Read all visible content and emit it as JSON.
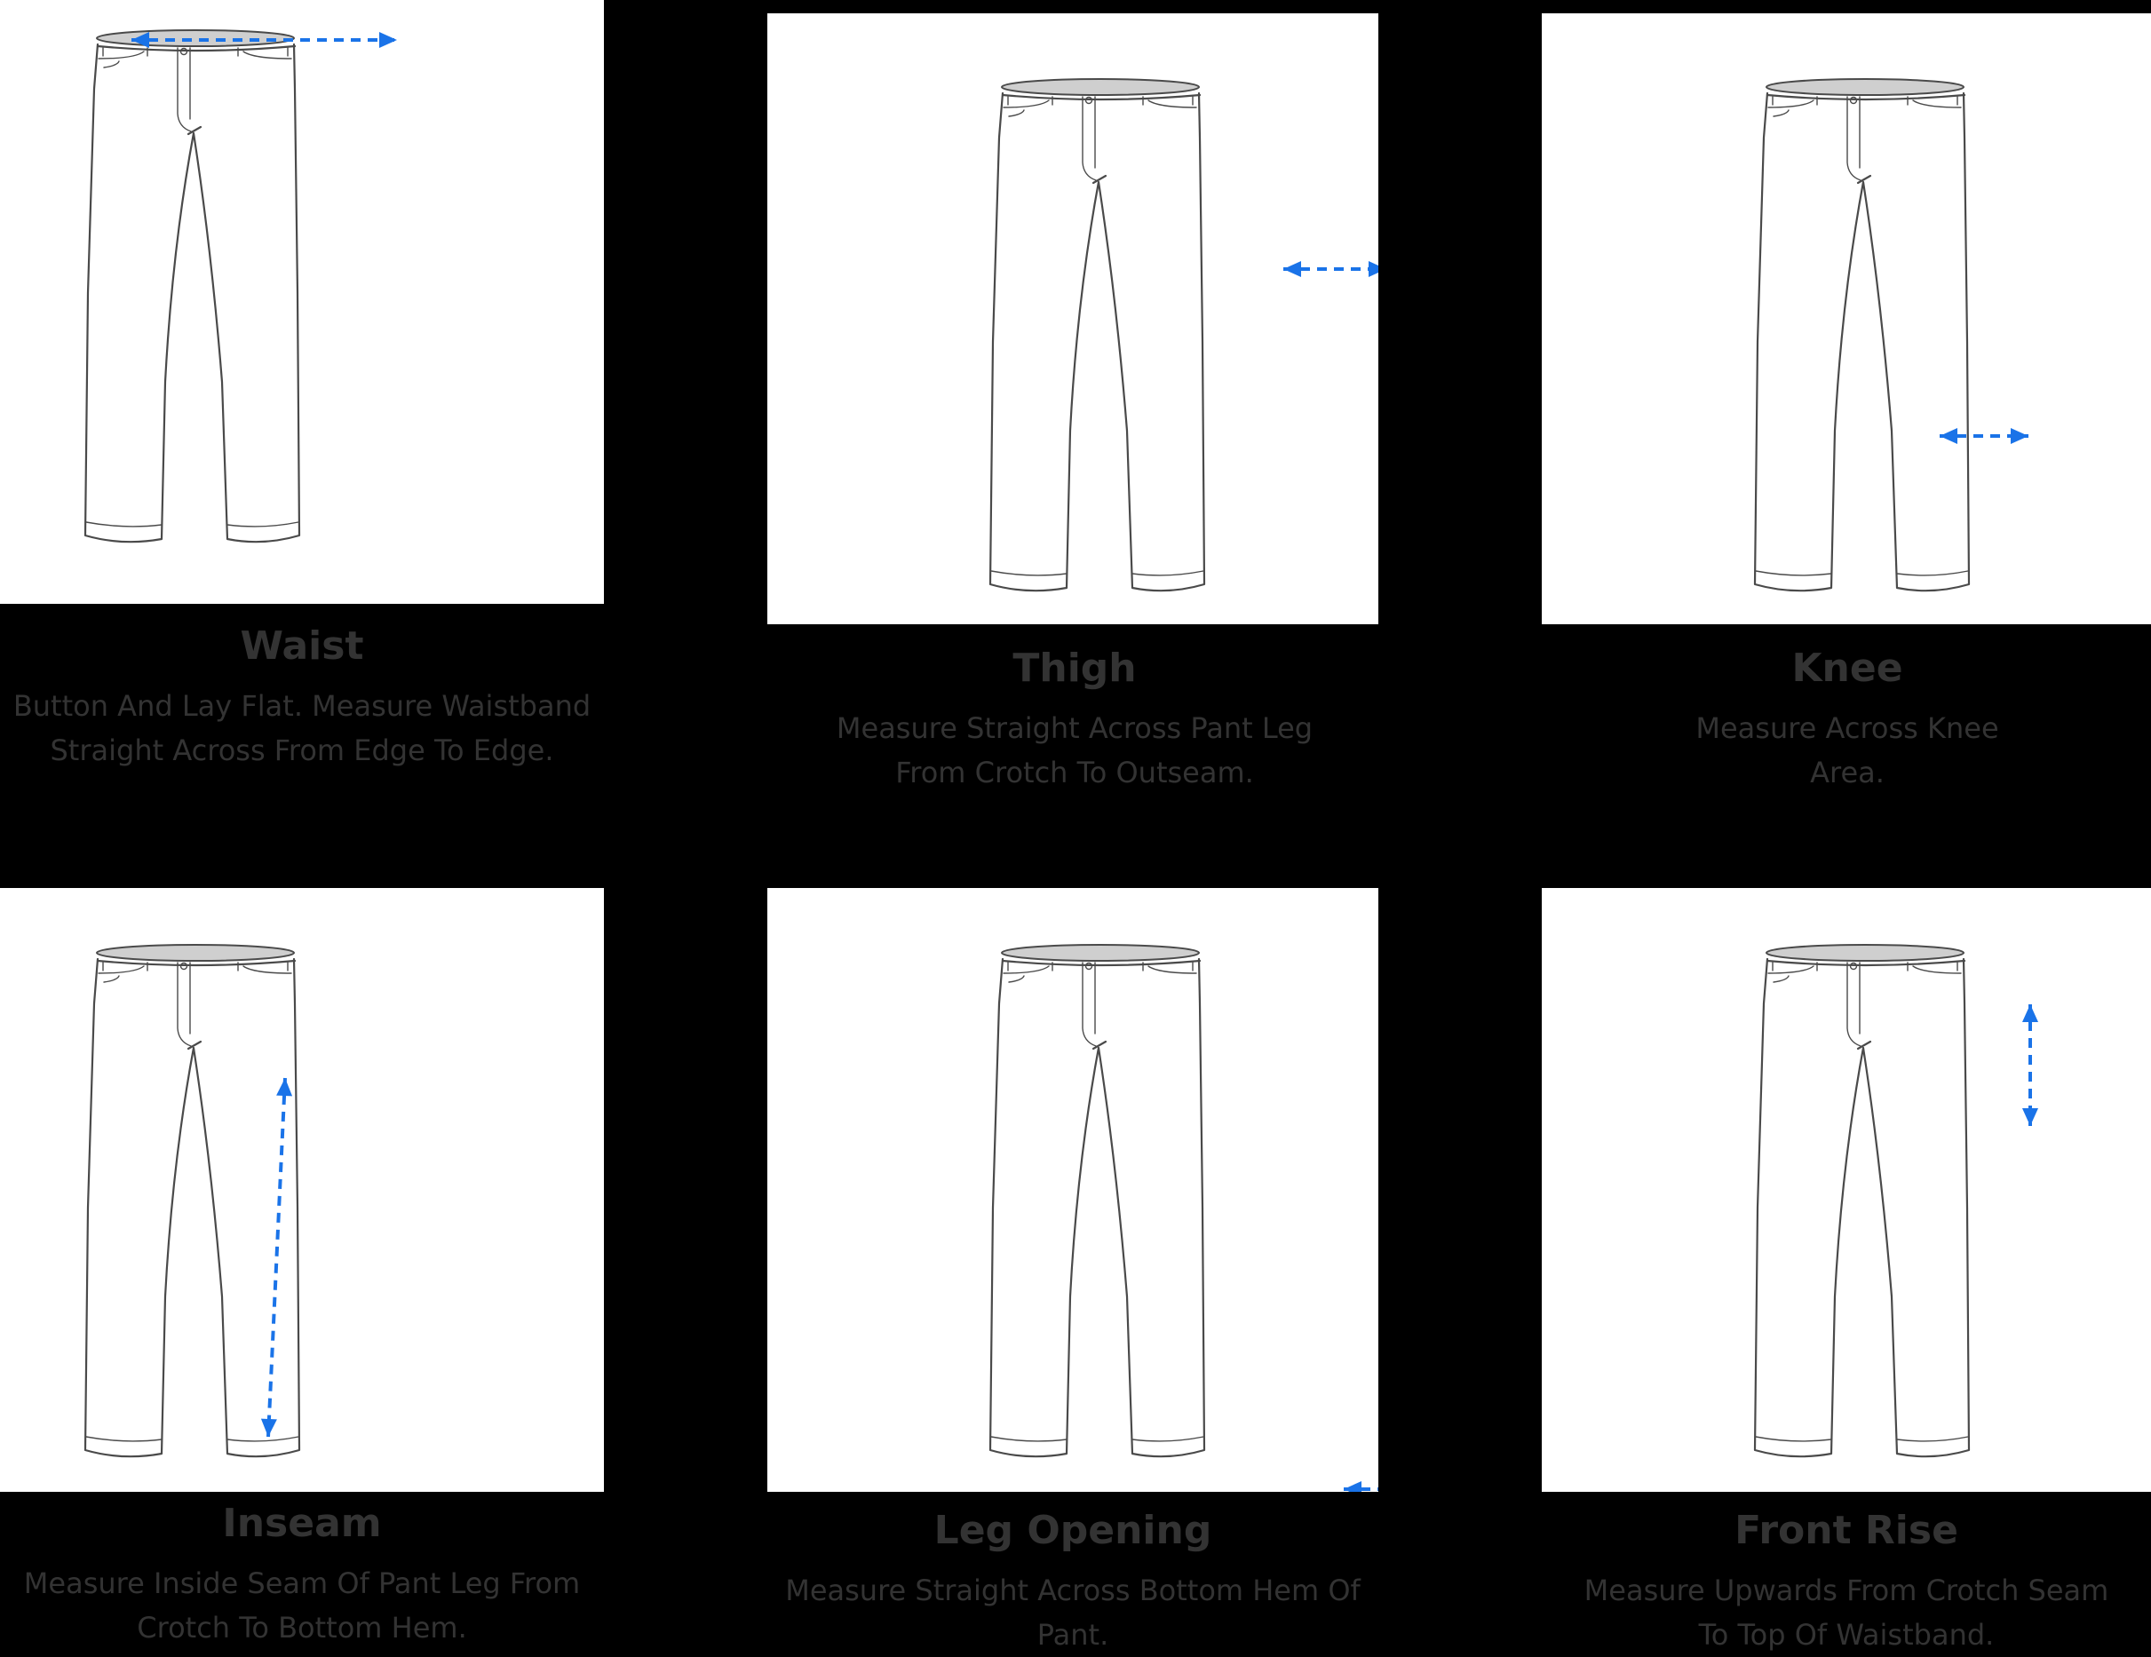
{
  "colors": {
    "page_background": "#000000",
    "panel_background": "#ffffff",
    "garment_line": "#4a4a4a",
    "waistband_fill": "#cfcfcf",
    "arrow": "#1a73e8",
    "caption_text": "#333333"
  },
  "panels": [
    {
      "measurement": "waist",
      "title": "Waist",
      "description": "Button And Lay Flat. Measure Waistband Straight Across From Edge To Edge."
    },
    {
      "measurement": "thigh",
      "title": "Thigh",
      "description": "Measure Straight Across Pant Leg From Crotch To Outseam."
    },
    {
      "measurement": "knee",
      "title": "Knee",
      "description": "Measure Across Knee Area."
    },
    {
      "measurement": "inseam",
      "title": "Inseam",
      "description": "Measure Inside Seam Of Pant Leg From Crotch To Bottom Hem."
    },
    {
      "measurement": "leg-opening",
      "title": "Leg Opening",
      "description": "Measure Straight Across Bottom Hem Of Pant."
    },
    {
      "measurement": "front-rise",
      "title": "Front Rise",
      "description": "Measure Upwards From Crotch Seam To Top Of Waistband."
    }
  ]
}
